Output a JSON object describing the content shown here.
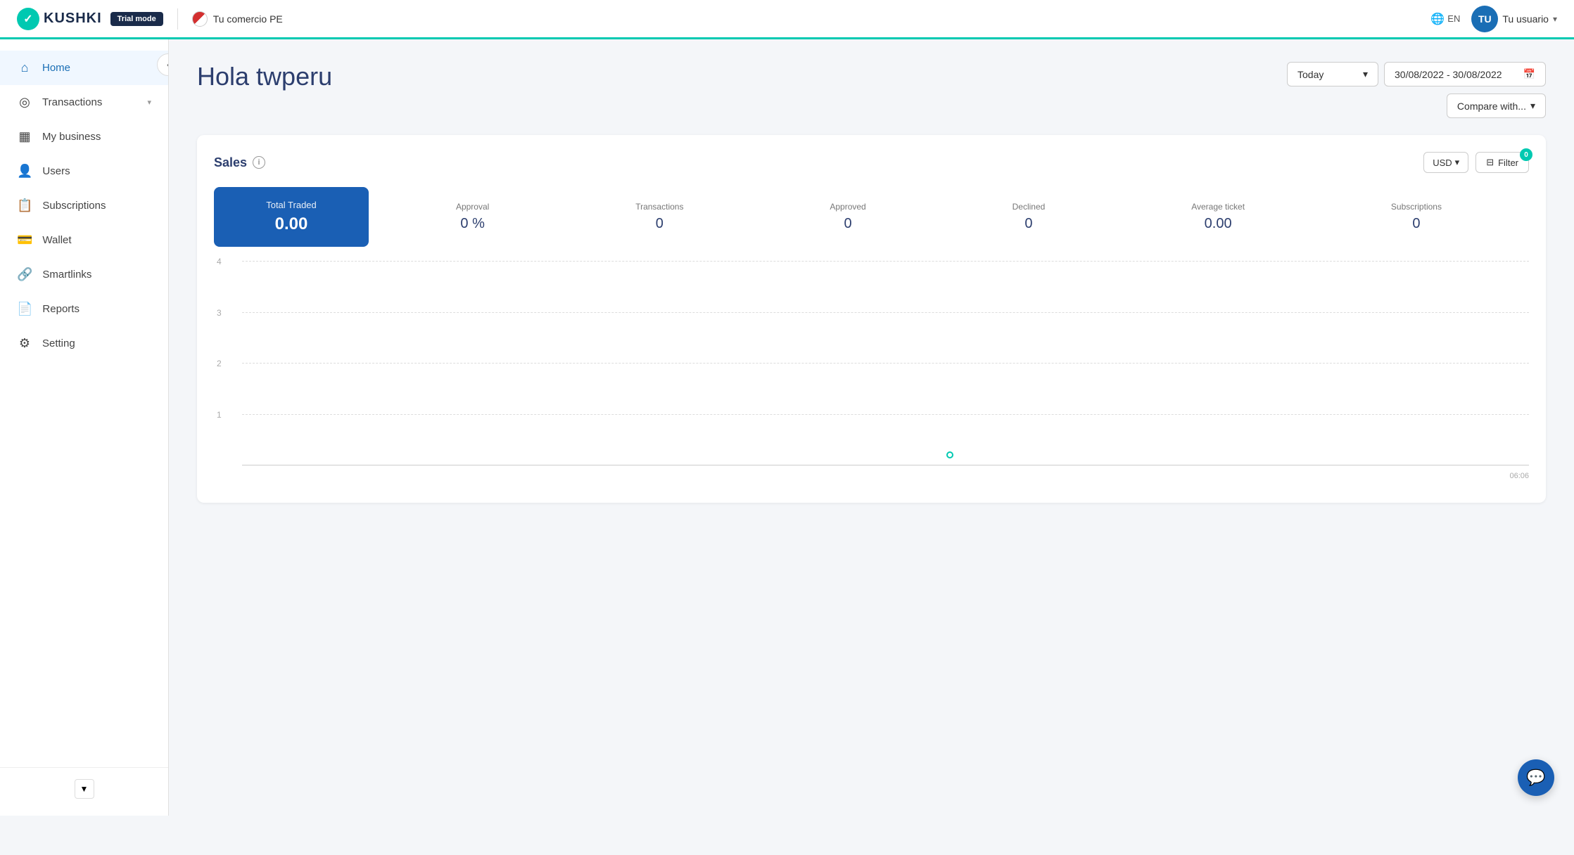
{
  "topnav": {
    "logo_text": "KUSHKI",
    "trial_badge": "Trial mode",
    "commerce_name": "Tu comercio PE",
    "language": "EN",
    "user_initials": "TU",
    "user_name": "Tu usuario"
  },
  "sidebar": {
    "collapse_icon": "‹",
    "items": [
      {
        "id": "home",
        "label": "Home",
        "icon": "⌂",
        "active": true
      },
      {
        "id": "transactions",
        "label": "Transactions",
        "icon": "◎",
        "has_chevron": true
      },
      {
        "id": "my-business",
        "label": "My business",
        "icon": "▦"
      },
      {
        "id": "users",
        "label": "Users",
        "icon": "👤"
      },
      {
        "id": "subscriptions",
        "label": "Subscriptions",
        "icon": "📋"
      },
      {
        "id": "wallet",
        "label": "Wallet",
        "icon": "💳"
      },
      {
        "id": "smartlinks",
        "label": "Smartlinks",
        "icon": "🔗"
      },
      {
        "id": "reports",
        "label": "Reports",
        "icon": "📄"
      },
      {
        "id": "setting",
        "label": "Setting",
        "icon": "⚙"
      }
    ],
    "scroll_down_icon": "▼"
  },
  "page": {
    "greeting": "Hola twperu",
    "period_label": "Today",
    "date_range": "30/08/2022 - 30/08/2022",
    "compare_label": "Compare with...",
    "sales_section": {
      "title": "Sales",
      "currency": "USD",
      "filter_label": "Filter",
      "filter_count": "0",
      "stats": {
        "total_traded_label": "Total Traded",
        "total_traded_value": "0.00",
        "approval_label": "Approval",
        "approval_value": "0 %",
        "transactions_label": "Transactions",
        "transactions_value": "0",
        "approved_label": "Approved",
        "approved_value": "0",
        "declined_label": "Declined",
        "declined_value": "0",
        "average_ticket_label": "Average ticket",
        "average_ticket_value": "0.00",
        "subscriptions_label": "Subscriptions",
        "subscriptions_value": "0"
      },
      "chart": {
        "y_labels": [
          "4",
          "3",
          "2",
          "1"
        ],
        "x_label": "06:06",
        "dot_x_pct": 55,
        "dot_y_pct": 92
      }
    }
  },
  "chat_fab_icon": "💬"
}
